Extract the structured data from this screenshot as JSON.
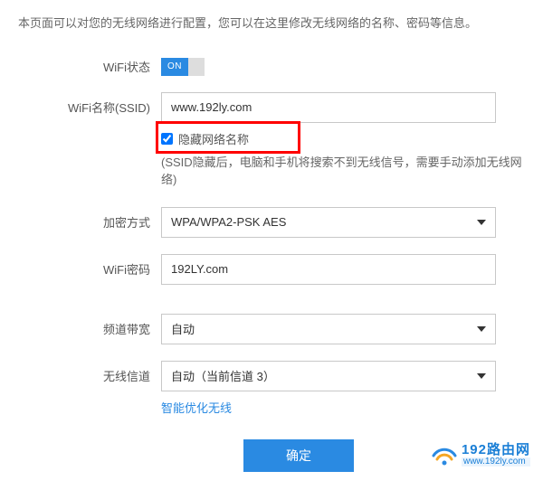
{
  "description": "本页面可以对您的无线网络进行配置，您可以在这里修改无线网络的名称、密码等信息。",
  "labels": {
    "wifi_status": "WiFi状态",
    "wifi_ssid": "WiFi名称(SSID)",
    "hide_ssid": "隐藏网络名称",
    "encryption": "加密方式",
    "wifi_password": "WiFi密码",
    "bandwidth": "频道带宽",
    "channel": "无线信道"
  },
  "values": {
    "wifi_status": "ON",
    "ssid": "www.192ly.com",
    "hide_ssid_checked": true,
    "encryption": "WPA/WPA2-PSK AES",
    "password": "192LY.com",
    "bandwidth": "自动",
    "channel": "自动（当前信道 3）"
  },
  "hint_ssid_hidden": "(SSID隐藏后，电脑和手机将搜索不到无线信号，需要手动添加无线网络)",
  "link_optimize": "智能优化无线",
  "button_submit": "确定",
  "logo": {
    "cn": "192路由网",
    "en": "www.192ly.com"
  }
}
